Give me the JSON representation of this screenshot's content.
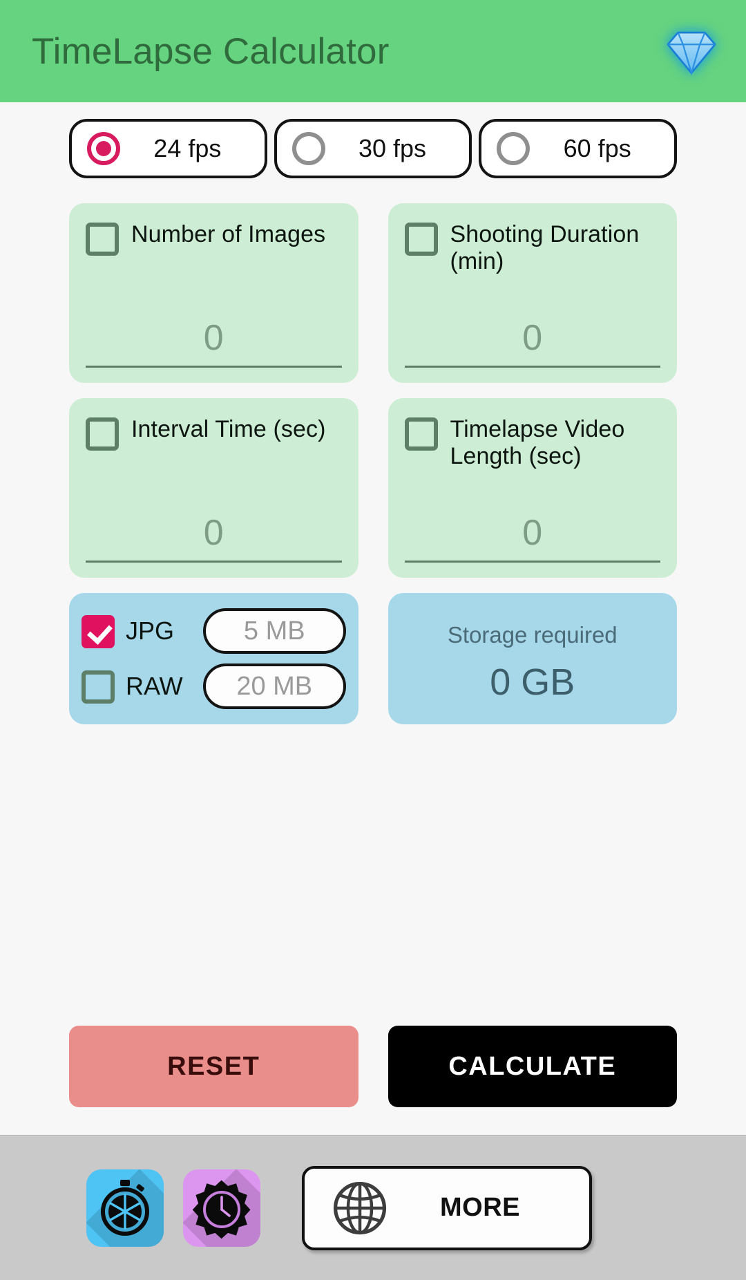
{
  "header": {
    "title": "TimeLapse Calculator",
    "background_color": "#65d37f",
    "title_color": "#2f6b3c",
    "gem_icon": "diamond-icon"
  },
  "fps_options": [
    {
      "label": "24 fps",
      "selected": true
    },
    {
      "label": "30 fps",
      "selected": false
    },
    {
      "label": "60 fps",
      "selected": false
    }
  ],
  "input_cards": [
    {
      "label": "Number of Images",
      "value": "0",
      "checked": false
    },
    {
      "label": "Shooting Duration (min)",
      "value": "0",
      "checked": false
    },
    {
      "label": "Interval Time (sec)",
      "value": "0",
      "checked": false
    },
    {
      "label": "Timelapse Video Length (sec)",
      "value": "0",
      "checked": false
    }
  ],
  "formats": [
    {
      "name": "JPG",
      "size": "5 MB",
      "checked": true
    },
    {
      "name": "RAW",
      "size": "20 MB",
      "checked": false
    }
  ],
  "storage": {
    "label": "Storage required",
    "value": "0 GB"
  },
  "actions": {
    "reset_label": "RESET",
    "calculate_label": "CALCULATE"
  },
  "bottom_bar": {
    "apps": [
      {
        "icon": "camera-shutter-stopwatch-icon",
        "color": "#4ec4f5"
      },
      {
        "icon": "gear-clock-icon",
        "color": "#dd96ef"
      }
    ],
    "more_label": "MORE",
    "more_icon": "globe-icon"
  },
  "colors": {
    "accent_pink": "#d81b5f",
    "card_green": "#cdeed4",
    "card_blue": "#a6d8ea",
    "reset_red": "#ea8e8b",
    "calculate_black": "#000000",
    "page_background": "#f7f7f7",
    "bottom_bar": "#c9c9c9"
  }
}
